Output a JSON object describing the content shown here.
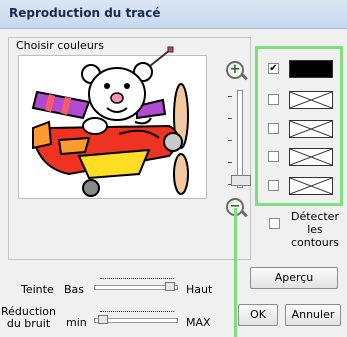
{
  "window": {
    "title": "Reproduction du tracé"
  },
  "group": {
    "label": "Choisir couleurs"
  },
  "palette": {
    "items": [
      {
        "checked": true,
        "color": "#000000",
        "empty": false
      },
      {
        "checked": false,
        "color": "#ffffff",
        "empty": true
      },
      {
        "checked": false,
        "color": "#ffffff",
        "empty": true
      },
      {
        "checked": false,
        "color": "#ffffff",
        "empty": true
      },
      {
        "checked": false,
        "color": "#ffffff",
        "empty": true
      }
    ],
    "highlight_color": "#7ee07a"
  },
  "contours": {
    "label_line1": "Détecter les",
    "label_line2": "contours",
    "checked": false
  },
  "teinte": {
    "label": "Teinte",
    "min_label": "Bas",
    "max_label": "Haut",
    "value": 0.98
  },
  "bruit": {
    "label_line1": "Réduction",
    "label_line2": "du bruit",
    "min_label": "min",
    "max_label": "MAX",
    "value": 0.05
  },
  "buttons": {
    "apercu": "Aperçu",
    "ok": "OK",
    "annuler": "Annuler"
  },
  "icons": {
    "zoom_in": "zoom-in-icon",
    "zoom_out": "zoom-out-icon",
    "pencil": "pencil-icon"
  },
  "zoom": {
    "level": 0.02
  }
}
